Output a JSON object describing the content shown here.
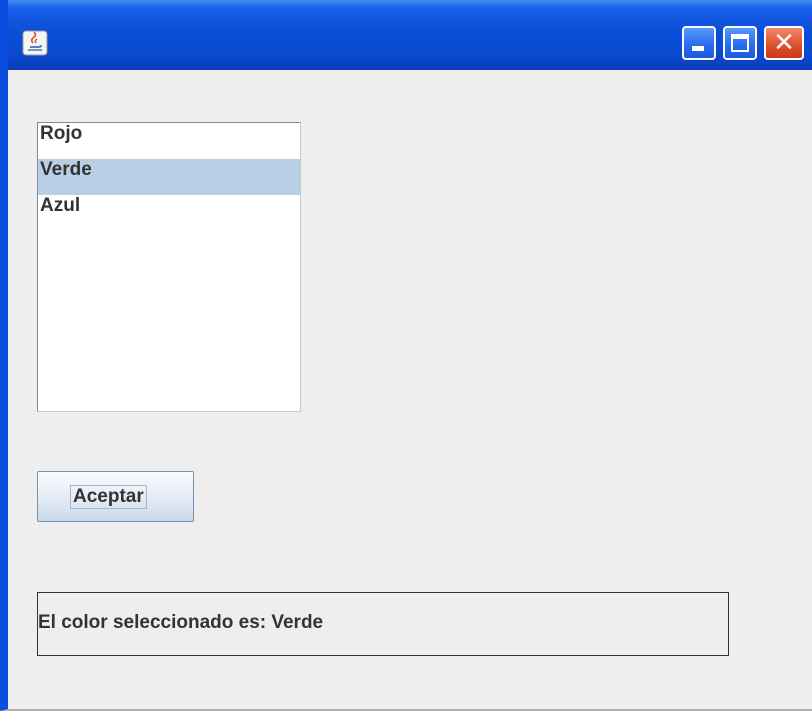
{
  "window": {
    "title": "",
    "app_icon": "java-coffee-cup-icon",
    "controls": {
      "minimize_icon": "minimize-icon",
      "maximize_icon": "maximize-icon",
      "close_icon": "close-icon",
      "close_glyph": "✕"
    },
    "colors": {
      "titlebar": "#0a48cc",
      "close": "#e0512c",
      "selection": "#b8cfe5",
      "background": "#eeeeee"
    }
  },
  "color_list": {
    "items": [
      {
        "label": "Rojo",
        "selected": false
      },
      {
        "label": "Verde",
        "selected": true
      },
      {
        "label": "Azul",
        "selected": false
      }
    ]
  },
  "accept_button": {
    "label": "Aceptar"
  },
  "result": {
    "text": "El color seleccionado es: Verde"
  }
}
